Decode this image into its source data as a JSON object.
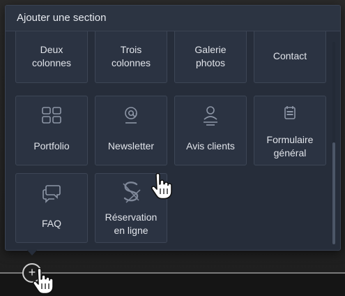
{
  "panel": {
    "title": "Ajouter une section"
  },
  "sections": [
    {
      "label_lines": [
        "Deux",
        "colonnes"
      ],
      "icon": "two-columns-icon"
    },
    {
      "label_lines": [
        "Trois",
        "colonnes"
      ],
      "icon": "three-columns-icon"
    },
    {
      "label_lines": [
        "Galerie",
        "photos"
      ],
      "icon": "photo-gallery-icon"
    },
    {
      "label_lines": [
        "Contact"
      ],
      "icon": "contact-icon"
    },
    {
      "label_lines": [
        "Portfolio"
      ],
      "icon": "grid-icon"
    },
    {
      "label_lines": [
        "Newsletter"
      ],
      "icon": "at-sign-icon"
    },
    {
      "label_lines": [
        "Avis clients"
      ],
      "icon": "user-review-icon"
    },
    {
      "label_lines": [
        "Formulaire",
        "général"
      ],
      "icon": "form-calendar-icon"
    },
    {
      "label_lines": [
        "FAQ"
      ],
      "icon": "chat-bubbles-icon"
    },
    {
      "label_lines": [
        "Réservation",
        "en ligne"
      ],
      "icon": "booking-logo-icon"
    }
  ],
  "add_button": {
    "symbol": "+"
  },
  "colors": {
    "panel_bg": "#262d3a",
    "card_bg": "#2b3342",
    "card_border": "#3d4656",
    "icon": "#8d96a6",
    "text": "#e1e4ea"
  }
}
